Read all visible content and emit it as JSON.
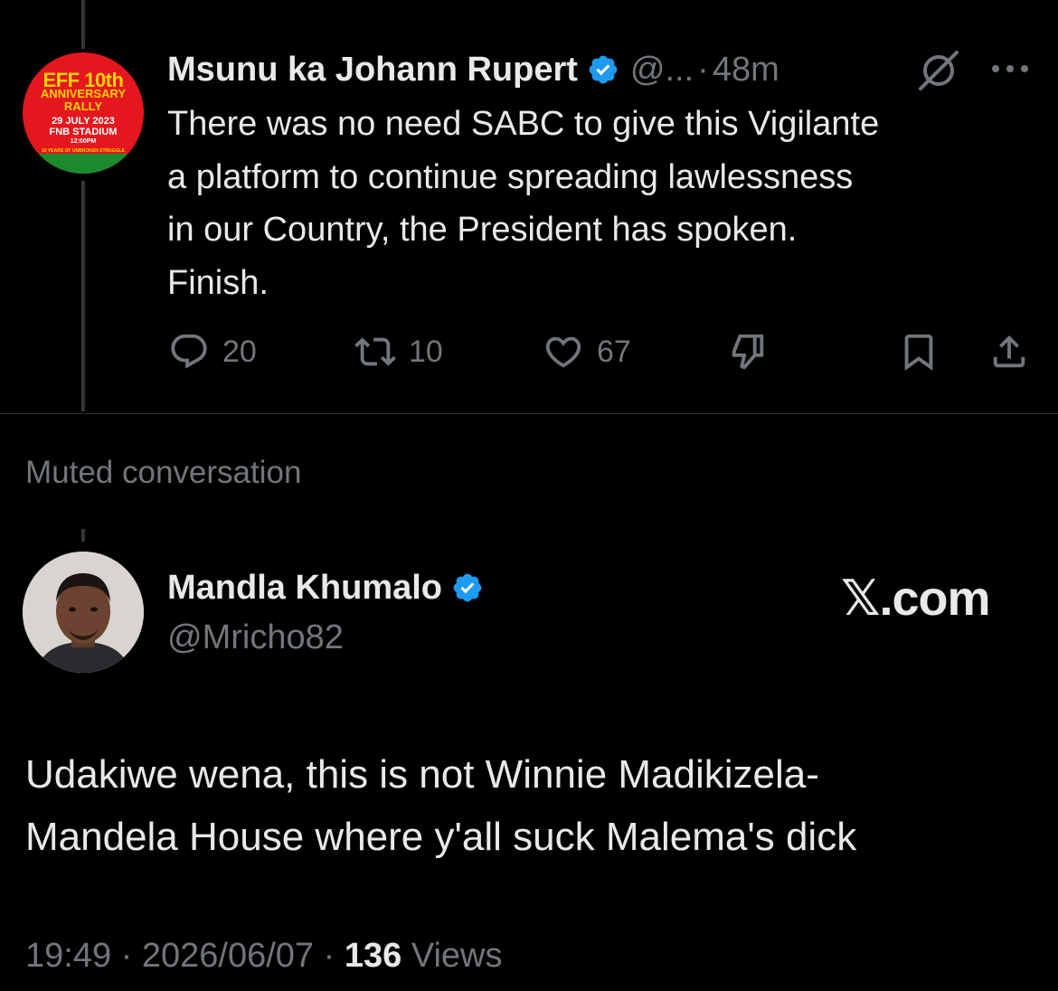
{
  "reply_tweet": {
    "display_name": "Msunu ka Johann Rupert",
    "handle": "@...",
    "separator": "·",
    "time": "48m",
    "avatar": {
      "line1": "EFF 10th",
      "line2": "ANNIVERSARY",
      "line3": "RALLY",
      "line4": "29 JULY 2023",
      "line5": "FNB STADIUM",
      "line6": "12:00PM",
      "line7": "10 YEARS OF UNBROKEN STRUGGLE"
    },
    "text": "There was no need SABC to give this Vigilante\na platform to continue spreading lawlessness\nin our Country, the President has spoken.\nFinish.",
    "actions": {
      "replies": "20",
      "retweets": "10",
      "likes": "67"
    }
  },
  "muted_label": "Muted conversation",
  "main_tweet": {
    "display_name": "Mandla Khumalo",
    "handle": "@Mricho82",
    "watermark": "𝕏.com",
    "text": "Udakiwe wena, this is not Winnie Madikizela-\nMandela House where y'all suck Malema's dick",
    "time": "19:49",
    "separator": "·",
    "date": "2026/06/07",
    "views_count": "136",
    "views_label": "Views"
  },
  "colors": {
    "background": "#000000",
    "text": "#e7e9ea",
    "secondary": "#71767b",
    "verified": "#1d9bf0",
    "divider": "#2f3336"
  }
}
